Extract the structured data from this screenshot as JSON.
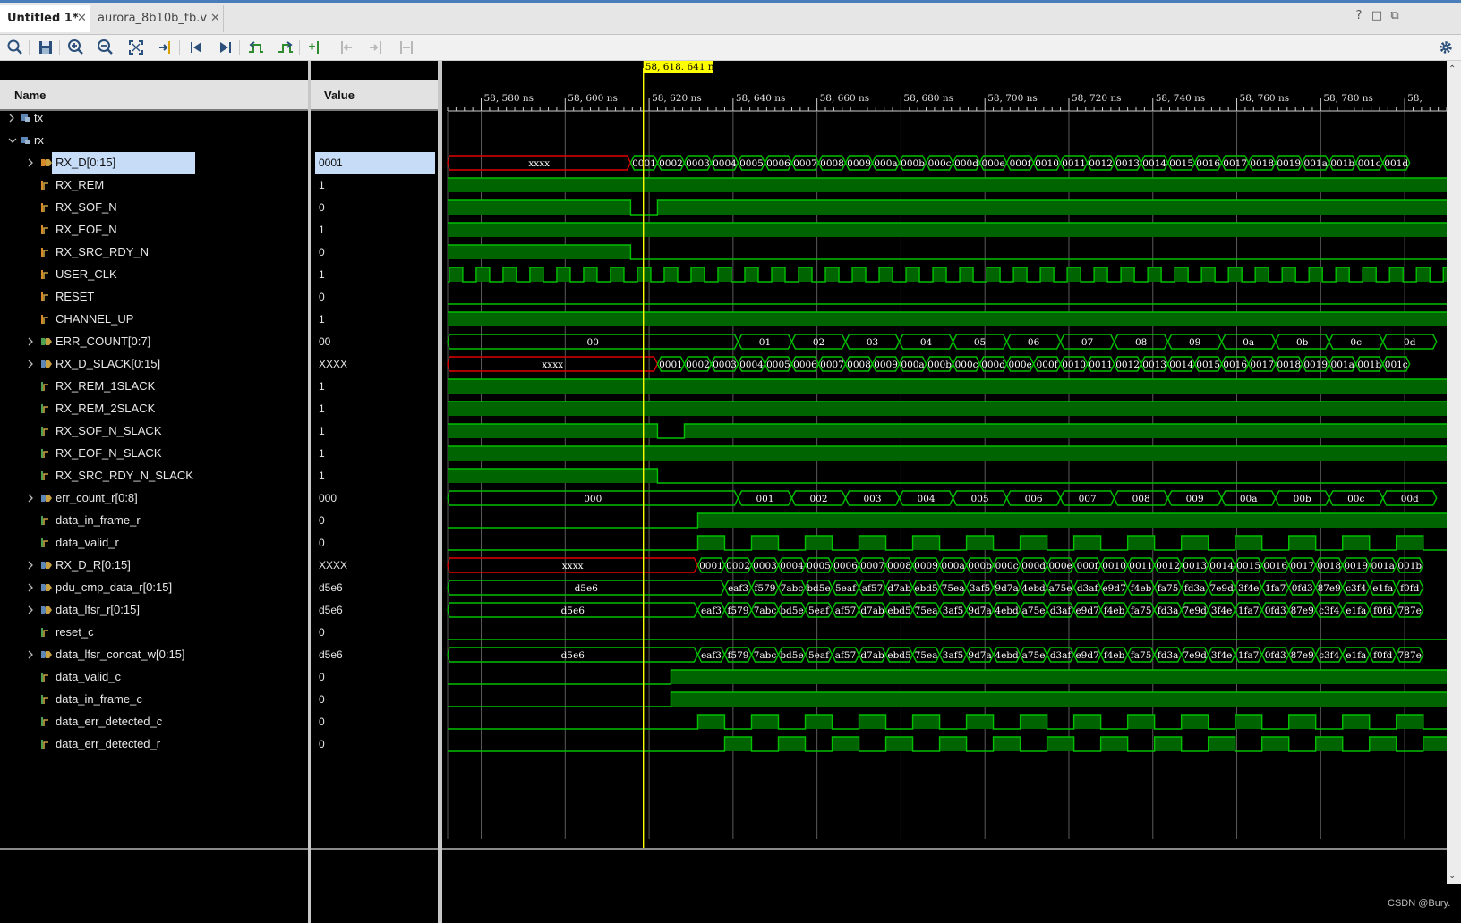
{
  "tabs": [
    {
      "label": "Untitled 1*"
    },
    {
      "label": "aurora_8b10b_tb.v"
    }
  ],
  "window_controls": [
    "?",
    "□",
    "⧉"
  ],
  "toolbar_icons": [
    "search-icon",
    "save-icon",
    "zoom-in-icon",
    "zoom-out-icon",
    "zoom-fit-icon",
    "go-to-cursor-icon",
    "go-to-start-icon",
    "go-to-end-icon",
    "previous-transition-icon",
    "next-transition-icon",
    "add-marker-icon",
    "previous-marker-icon",
    "next-marker-icon",
    "swap-cursors-icon",
    "settings-icon"
  ],
  "columns": {
    "name": "Name",
    "value": "Value"
  },
  "cursor": {
    "label": "58, 618. 641 ns",
    "time": 58618.641
  },
  "time_axis": {
    "start": 58572,
    "end": 58810,
    "major_step": 20,
    "unit": "ns",
    "labels": [
      "58, 580 ns",
      "58, 600 ns",
      "58, 620 ns",
      "58, 640 ns",
      "58, 660 ns",
      "58, 680 ns",
      "58, 700 ns",
      "58, 720 ns",
      "58, 740 ns",
      "58, 760 ns",
      "58, 780 ns",
      "58, "
    ]
  },
  "groups": [
    {
      "name": "tx",
      "expanded": false
    },
    {
      "name": "rx",
      "expanded": true
    }
  ],
  "signals": [
    {
      "name": "RX_D[0:15]",
      "value": "0001",
      "bus": true,
      "expandable": true,
      "icon": "bus-in",
      "selected": true
    },
    {
      "name": "RX_REM",
      "value": "1",
      "icon": "bit-in"
    },
    {
      "name": "RX_SOF_N",
      "value": "0",
      "icon": "bit-in"
    },
    {
      "name": "RX_EOF_N",
      "value": "1",
      "icon": "bit-in"
    },
    {
      "name": "RX_SRC_RDY_N",
      "value": "0",
      "icon": "bit-in"
    },
    {
      "name": "USER_CLK",
      "value": "1",
      "icon": "bit-in"
    },
    {
      "name": "RESET",
      "value": "0",
      "icon": "bit-in"
    },
    {
      "name": "CHANNEL_UP",
      "value": "1",
      "icon": "bit-in"
    },
    {
      "name": "ERR_COUNT[0:7]",
      "value": "00",
      "bus": true,
      "expandable": true,
      "icon": "bus-out"
    },
    {
      "name": "RX_D_SLACK[0:15]",
      "value": "XXXX",
      "bus": true,
      "expandable": true,
      "icon": "bus"
    },
    {
      "name": "RX_REM_1SLACK",
      "value": "1",
      "icon": "bit"
    },
    {
      "name": "RX_REM_2SLACK",
      "value": "1",
      "icon": "bit"
    },
    {
      "name": "RX_SOF_N_SLACK",
      "value": "1",
      "icon": "bit"
    },
    {
      "name": "RX_EOF_N_SLACK",
      "value": "1",
      "icon": "bit"
    },
    {
      "name": "RX_SRC_RDY_N_SLACK",
      "value": "1",
      "icon": "bit"
    },
    {
      "name": "err_count_r[0:8]",
      "value": "000",
      "bus": true,
      "expandable": true,
      "icon": "bus"
    },
    {
      "name": "data_in_frame_r",
      "value": "0",
      "icon": "bit"
    },
    {
      "name": "data_valid_r",
      "value": "0",
      "icon": "bit"
    },
    {
      "name": "RX_D_R[0:15]",
      "value": "XXXX",
      "bus": true,
      "expandable": true,
      "icon": "bus"
    },
    {
      "name": "pdu_cmp_data_r[0:15]",
      "value": "d5e6",
      "bus": true,
      "expandable": true,
      "icon": "bus"
    },
    {
      "name": "data_lfsr_r[0:15]",
      "value": "d5e6",
      "bus": true,
      "expandable": true,
      "icon": "bus"
    },
    {
      "name": "reset_c",
      "value": "0",
      "icon": "bit"
    },
    {
      "name": "data_lfsr_concat_w[0:15]",
      "value": "d5e6",
      "bus": true,
      "expandable": true,
      "icon": "bus"
    },
    {
      "name": "data_valid_c",
      "value": "0",
      "icon": "bit"
    },
    {
      "name": "data_in_frame_c",
      "value": "0",
      "icon": "bit"
    },
    {
      "name": "data_err_detected_c",
      "value": "0",
      "icon": "bit"
    },
    {
      "name": "data_err_detected_r",
      "value": "0",
      "icon": "bit"
    }
  ],
  "waves": {
    "clk_period": 6.4,
    "clk_start": 58572.4,
    "t_data": 58615.6,
    "bits": {
      "RX_REM": {
        "init": 1,
        "edges": []
      },
      "RX_SOF_N": {
        "init": 1,
        "edges": [
          58615.6,
          58622.0
        ]
      },
      "RX_EOF_N": {
        "init": 1,
        "edges": []
      },
      "RX_SRC_RDY_N": {
        "init": 1,
        "edges": [
          58615.6
        ]
      },
      "RESET": {
        "init": 0,
        "edges": []
      },
      "CHANNEL_UP": {
        "init": 1,
        "edges": []
      },
      "RX_REM_1SLACK": {
        "init": 1,
        "edges": []
      },
      "RX_REM_2SLACK": {
        "init": 1,
        "edges": []
      },
      "RX_SOF_N_SLACK": {
        "init": 1,
        "edges": [
          58622.0,
          58628.4
        ]
      },
      "RX_EOF_N_SLACK": {
        "init": 1,
        "edges": []
      },
      "RX_SRC_RDY_N_SLACK": {
        "init": 1,
        "edges": [
          58622.0
        ]
      },
      "data_in_frame_r": {
        "init": 0,
        "edges": [
          58631.6
        ]
      },
      "reset_c": {
        "init": 0,
        "edges": []
      },
      "data_valid_c": {
        "init": 0,
        "edges": [
          58625.2
        ]
      },
      "data_in_frame_c": {
        "init": 0,
        "edges": [
          58625.2
        ]
      }
    },
    "pulses": {
      "data_valid_r": {
        "start": 58631.6
      },
      "data_err_detected_c": {
        "start": 58631.6
      },
      "data_err_detected_r": {
        "start": 58638.0
      }
    },
    "buses": {
      "RX_D[0:15]": {
        "init": "xxxx",
        "unknown": true,
        "seq_start": 58615.6,
        "seq": [
          "0001",
          "0002",
          "0003",
          "0004",
          "0005",
          "0006",
          "0007",
          "0008",
          "0009",
          "000a",
          "000b",
          "000c",
          "000d",
          "000e",
          "000f",
          "0010",
          "0011",
          "0012",
          "0013",
          "0014",
          "0015",
          "0016",
          "0017",
          "0018",
          "0019",
          "001a",
          "001b",
          "001c",
          "001d"
        ]
      },
      "ERR_COUNT[0:7]": {
        "init": "00",
        "seq_start": 58641.2,
        "step": 12.8,
        "seq": [
          "01",
          "02",
          "03",
          "04",
          "05",
          "06",
          "07",
          "08",
          "09",
          "0a",
          "0b",
          "0c",
          "0d"
        ]
      },
      "RX_D_SLACK[0:15]": {
        "init": "xxxx",
        "unknown": true,
        "seq_start": 58622.0,
        "seq": [
          "0001",
          "0002",
          "0003",
          "0004",
          "0005",
          "0006",
          "0007",
          "0008",
          "0009",
          "000a",
          "000b",
          "000c",
          "000d",
          "000e",
          "000f",
          "0010",
          "0011",
          "0012",
          "0013",
          "0014",
          "0015",
          "0016",
          "0017",
          "0018",
          "0019",
          "001a",
          "001b",
          "001c"
        ]
      },
      "err_count_r[0:8]": {
        "init": "000",
        "seq_start": 58641.2,
        "step": 12.8,
        "seq": [
          "001",
          "002",
          "003",
          "004",
          "005",
          "006",
          "007",
          "008",
          "009",
          "00a",
          "00b",
          "00c",
          "00d"
        ]
      },
      "RX_D_R[0:15]": {
        "init": "xxxx",
        "unknown": true,
        "seq_start": 58631.6,
        "seq": [
          "0001",
          "0002",
          "0003",
          "0004",
          "0005",
          "0006",
          "0007",
          "0008",
          "0009",
          "000a",
          "000b",
          "000c",
          "000d",
          "000e",
          "000f",
          "0010",
          "0011",
          "0012",
          "0013",
          "0014",
          "0015",
          "0016",
          "0017",
          "0018",
          "0019",
          "001a",
          "001b"
        ]
      },
      "pdu_cmp_data_r[0:15]": {
        "init": "d5e6",
        "seq_start": 58638.0,
        "seq": [
          "eaf3",
          "f579",
          "7abc",
          "bd5e",
          "5eaf",
          "af57",
          "d7ab",
          "ebd5",
          "75ea",
          "3af5",
          "9d7a",
          "4ebd",
          "a75e",
          "d3af",
          "e9d7",
          "f4eb",
          "fa75",
          "fd3a",
          "7e9d",
          "3f4e",
          "1fa7",
          "0fd3",
          "87e9",
          "c3f4",
          "e1fa",
          "f0fd"
        ]
      },
      "data_lfsr_r[0:15]": {
        "init": "d5e6",
        "seq_start": 58631.6,
        "seq": [
          "eaf3",
          "f579",
          "7abc",
          "bd5e",
          "5eaf",
          "af57",
          "d7ab",
          "ebd5",
          "75ea",
          "3af5",
          "9d7a",
          "4ebd",
          "a75e",
          "d3af",
          "e9d7",
          "f4eb",
          "fa75",
          "fd3a",
          "7e9d",
          "3f4e",
          "1fa7",
          "0fd3",
          "87e9",
          "c3f4",
          "e1fa",
          "f0fd",
          "787e"
        ]
      },
      "data_lfsr_concat_w[0:15]": {
        "init": "d5e6",
        "seq_start": 58631.6,
        "seq": [
          "eaf3",
          "f579",
          "7abc",
          "bd5e",
          "5eaf",
          "af57",
          "d7ab",
          "ebd5",
          "75ea",
          "3af5",
          "9d7a",
          "4ebd",
          "a75e",
          "d3af",
          "e9d7",
          "f4eb",
          "fa75",
          "fd3a",
          "7e9d",
          "3f4e",
          "1fa7",
          "0fd3",
          "87e9",
          "c3f4",
          "e1fa",
          "f0fd",
          "787e"
        ]
      }
    }
  },
  "watermark": "CSDN @Bury.",
  "colors": {
    "wave": "#00c000",
    "wave_fill": "#006400",
    "unknown": "#e00000",
    "cursor": "#ffff00",
    "selected_row": "#c6dcf7",
    "panel_header": "#e2e2e2",
    "background": "#000000"
  }
}
